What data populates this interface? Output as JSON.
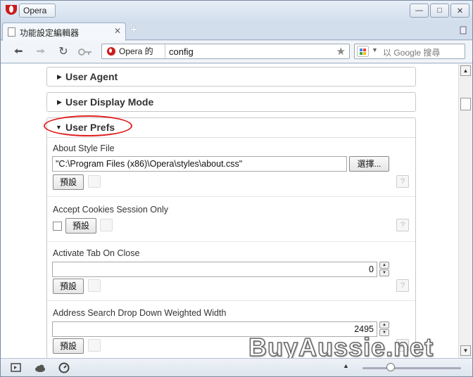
{
  "window": {
    "app_menu_label": "Opera"
  },
  "tab": {
    "title": "功能設定編輯器"
  },
  "address_bar": {
    "site_badge": "Opera 的",
    "url": "config"
  },
  "search": {
    "placeholder": "以 Google 搜尋"
  },
  "sections": {
    "user_agent": "User Agent",
    "user_display_mode": "User Display Mode",
    "user_prefs": "User Prefs"
  },
  "prefs": {
    "about_style_file": {
      "label": "About Style File",
      "value": "\"C:\\Program Files (x86)\\Opera\\styles\\about.css\"",
      "choose_label": "選擇...",
      "default_label": "預設"
    },
    "accept_cookies_session_only": {
      "label": "Accept Cookies Session Only",
      "default_label": "預設"
    },
    "activate_tab_on_close": {
      "label": "Activate Tab On Close",
      "value": "0",
      "default_label": "預設"
    },
    "address_search_drop_down_weighted_width": {
      "label": "Address Search Drop Down Weighted Width",
      "value": "2495",
      "default_label": "預設"
    },
    "help_label": "?"
  },
  "watermark": {
    "text": "BuyAussie.net"
  },
  "colors": {
    "opera_red": "#cc1b1b",
    "highlight_ellipse": "#e02020"
  }
}
